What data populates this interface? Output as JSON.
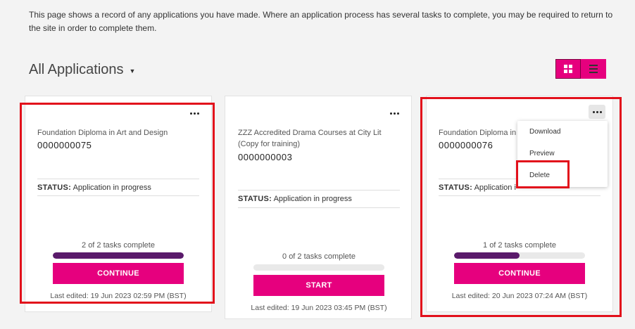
{
  "intro_text": "This page shows a record of any applications you have made.  Where an application process has several tasks to complete, you may be required to return to the site in order to complete them.",
  "heading": "All Applications",
  "heading_caret": "▼",
  "view_toggle": {
    "grid_icon": "grid-icon",
    "list_icon": "list-icon",
    "selected": "grid"
  },
  "status_label": "STATUS:",
  "cards": [
    {
      "title": "Foundation Diploma in Art and Design",
      "reference": "0000000075",
      "status": "Application in progress",
      "progress_text": "2 of 2 tasks complete",
      "progress": 1.0,
      "button_label": "CONTINUE",
      "last_edited": "Last edited: 19 Jun 2023 02:59 PM (BST)"
    },
    {
      "title": "ZZZ Accredited Drama Courses at City Lit (Copy for training)",
      "reference": "0000000003",
      "status": "Application in progress",
      "progress_text": "0 of 2 tasks complete",
      "progress": 0.0,
      "button_label": "START",
      "last_edited": "Last edited: 19 Jun 2023 03:45 PM (BST)"
    },
    {
      "title": "Foundation Diploma in A",
      "reference": "0000000076",
      "status": "Application i",
      "progress_text": "1 of 2 tasks complete",
      "progress": 0.5,
      "button_label": "CONTINUE",
      "last_edited": "Last edited: 20 Jun 2023 07:24 AM (BST)"
    }
  ],
  "menu": {
    "items": [
      "Download",
      "Preview",
      "Delete"
    ]
  },
  "colors": {
    "accent": "#e6007e",
    "progress_fill": "#5a1a6b",
    "highlight": "#e2101b",
    "background": "#f3f3f3"
  }
}
